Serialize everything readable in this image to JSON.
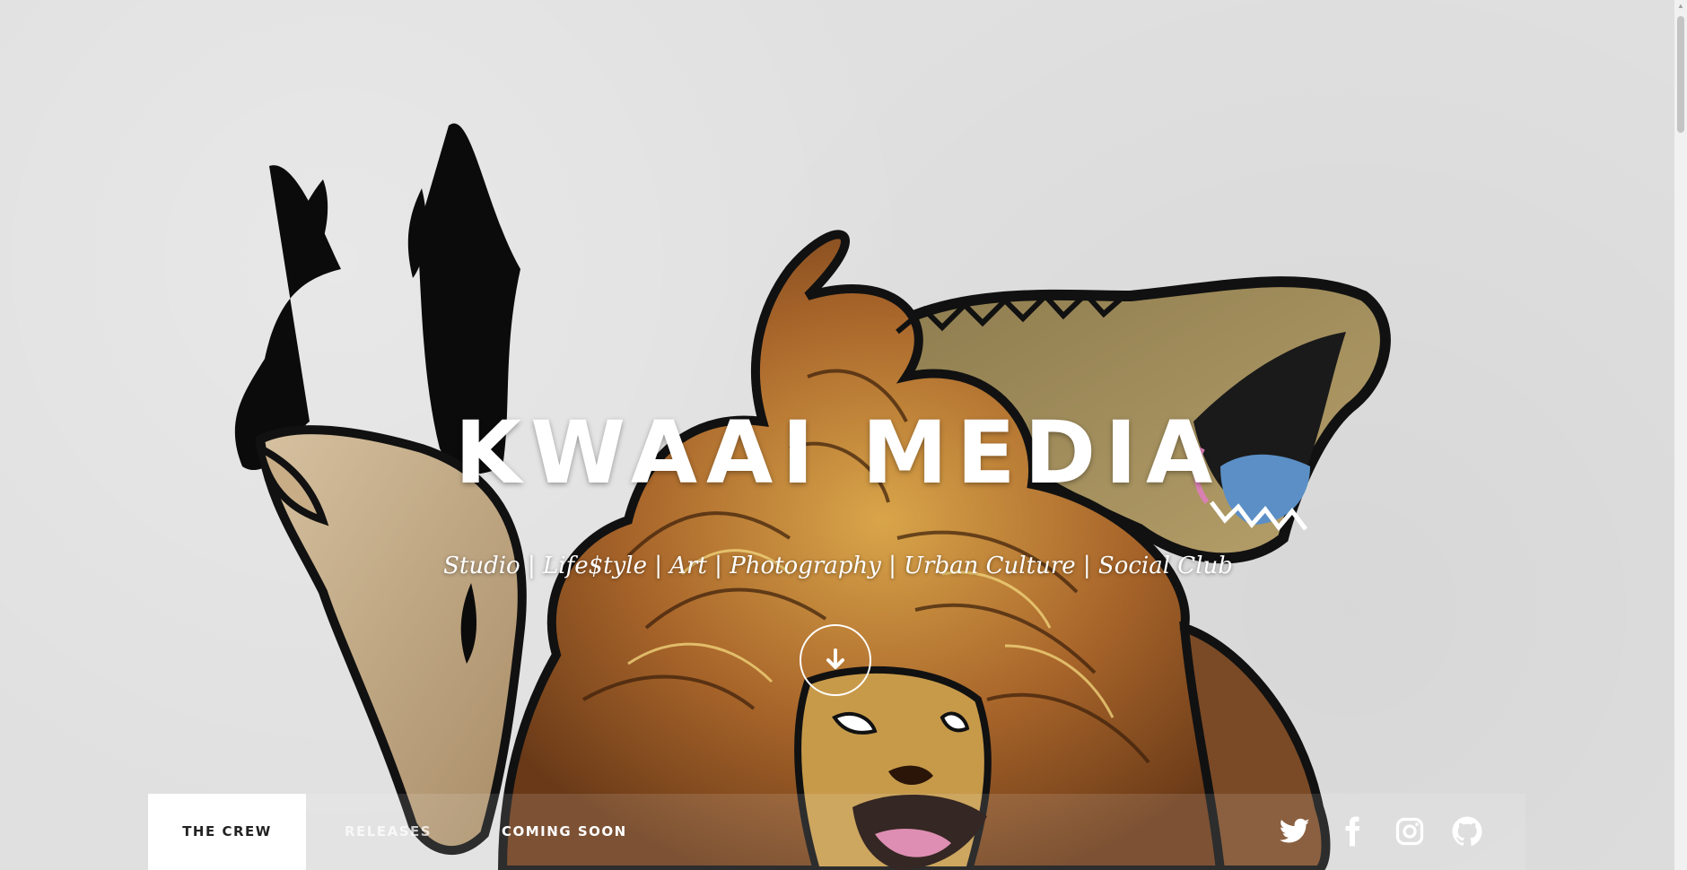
{
  "hero": {
    "title": "KWAAI MEDIA",
    "tagline": "Studio | Life$tyle | Art | Photography | Urban Culture | Social Club"
  },
  "scroll_button": {
    "icon": "arrow-down-icon"
  },
  "nav": {
    "items": [
      {
        "label": "The Crew",
        "active": true
      },
      {
        "label": "Releases",
        "active": false
      },
      {
        "label": "Coming Soon",
        "active": false
      }
    ],
    "social": [
      {
        "name": "twitter-icon"
      },
      {
        "name": "facebook-icon"
      },
      {
        "name": "instagram-icon"
      },
      {
        "name": "github-icon"
      }
    ]
  },
  "colors": {
    "background": "#e0e0e0",
    "text": "#ffffff",
    "active_nav_bg": "#ffffff",
    "active_nav_text": "#222222"
  }
}
